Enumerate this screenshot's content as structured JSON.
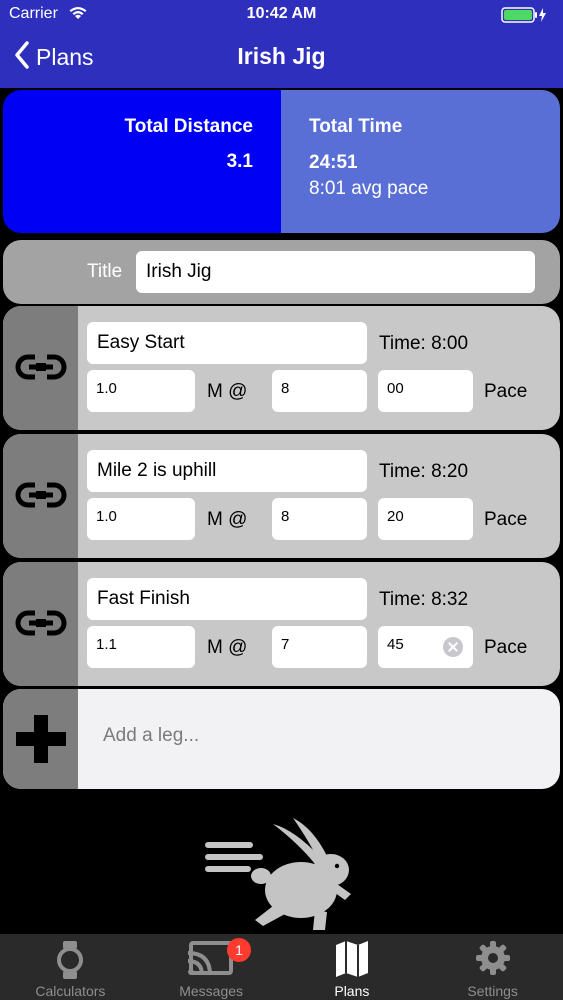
{
  "status_bar": {
    "carrier": "Carrier",
    "time": "10:42 AM"
  },
  "nav": {
    "back_label": "Plans",
    "title": "Irish Jig"
  },
  "summary": {
    "distance_label": "Total Distance",
    "distance_value": "3.1",
    "time_label": "Total Time",
    "time_value": "24:51",
    "avg_pace": "8:01 avg pace"
  },
  "title_field": {
    "label": "Title",
    "value": "Irish Jig"
  },
  "legs": [
    {
      "name": "Easy Start",
      "time": "Time: 8:00",
      "distance": "1.0",
      "unit": "M @",
      "pace_min": "8",
      "pace_sec": "00",
      "pace_label": "Pace"
    },
    {
      "name": "Mile 2 is uphill",
      "time": "Time: 8:20",
      "distance": "1.0",
      "unit": "M @",
      "pace_min": "8",
      "pace_sec": "20",
      "pace_label": "Pace"
    },
    {
      "name": "Fast Finish",
      "time": "Time: 8:32",
      "distance": "1.1",
      "unit": "M @",
      "pace_min": "7",
      "pace_sec": "45",
      "pace_label": "Pace"
    }
  ],
  "add_leg": {
    "placeholder": "Add a leg..."
  },
  "tabs": [
    {
      "label": "Calculators",
      "icon": "watch-icon"
    },
    {
      "label": "Messages",
      "icon": "cast-icon",
      "badge": "1"
    },
    {
      "label": "Plans",
      "icon": "map-icon",
      "active": true
    },
    {
      "label": "Settings",
      "icon": "gear-icon"
    }
  ],
  "colors": {
    "nav_bg": "#2e2fbd",
    "distance_bg": "#0000f5",
    "time_bg": "#5a6fd6",
    "badge": "#ff3b30"
  }
}
